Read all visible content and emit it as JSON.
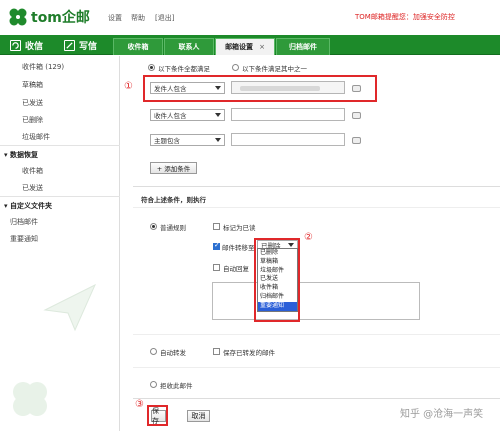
{
  "header": {
    "brand": "tom企邮",
    "links": [
      "设置",
      "帮助",
      "[退出]"
    ],
    "notice": "TOM邮箱提醒您：加强安全防控"
  },
  "nav": {
    "inbox": "收信",
    "compose": "写信",
    "tabs": [
      {
        "label": "收件箱",
        "active": false
      },
      {
        "label": "联系人",
        "active": false
      },
      {
        "label": "邮箱设置",
        "active": true,
        "close": "×"
      },
      {
        "label": "归档邮件",
        "active": false
      }
    ]
  },
  "sidebar": {
    "folders": [
      "收件箱 (129)",
      "草稿箱",
      "已发送",
      "已删除",
      "垃圾邮件"
    ],
    "recovery_title": "数据恢复",
    "recovery_items": [
      "收件箱",
      "已发送"
    ],
    "custom_title": "自定义文件夹",
    "custom_items": [
      "归档邮件",
      "重要通知"
    ]
  },
  "filter": {
    "match_all": "以下条件全都满足",
    "match_any": "以下条件满足其中之一",
    "conditions": [
      "发件人包含",
      "收件人包含",
      "主题包含"
    ],
    "add_condition": "+ 添加条件",
    "section_title": "符合上述条件，则执行",
    "normal_rule": "普通规则",
    "mark_read": "标记为已读",
    "move_to": "邮件转移至",
    "move_selected": "已删除",
    "auto_reply": "自动回复",
    "auto_forward": "自动转发",
    "keep_forwarded": "保存已转发的邮件",
    "reject": "拒收此邮件",
    "save": "保存",
    "cancel": "取消",
    "dropdown_options": [
      "已删除",
      "草稿箱",
      "垃圾邮件",
      "已发送",
      "收件箱",
      "归档邮件",
      "重要通知"
    ],
    "dropdown_highlight": "重要通知"
  },
  "markers": [
    "①",
    "②",
    "③"
  ],
  "watermark": "知乎 @沧海一声笑",
  "colors": {
    "nav_green": "#1d8a2a",
    "annotation_red": "#e0282a",
    "highlight_blue": "#2b5fd8"
  }
}
